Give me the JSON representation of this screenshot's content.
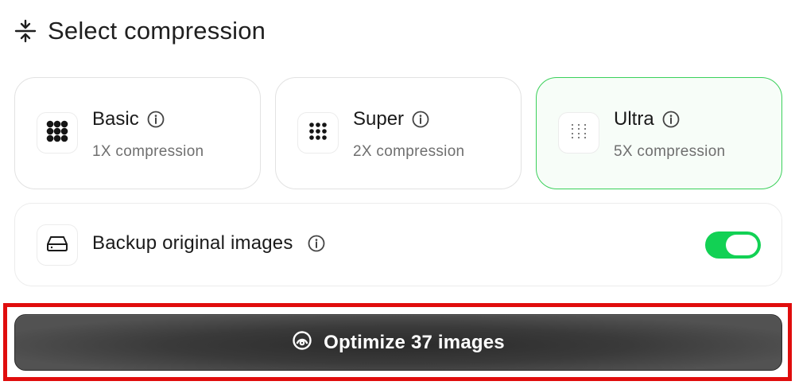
{
  "header": {
    "title": "Select compression",
    "icon": "compress-icon"
  },
  "compression_options": [
    {
      "name": "Basic",
      "subtitle": "1X compression",
      "icon": "dense-dots-icon",
      "selected": false
    },
    {
      "name": "Super",
      "subtitle": "2X compression",
      "icon": "medium-dots-icon",
      "selected": false
    },
    {
      "name": "Ultra",
      "subtitle": "5X compression",
      "icon": "sparse-dots-icon",
      "selected": true
    }
  ],
  "backup": {
    "label": "Backup original images",
    "icon": "hard-drive-icon",
    "enabled": true
  },
  "action": {
    "label": "Optimize 37 images",
    "icon": "optimize-icon"
  },
  "colors": {
    "accent_green": "#12d154",
    "selected_border": "#3ad05a",
    "button_dark": "#3a3a3a",
    "highlight_red": "#e00d0d"
  }
}
